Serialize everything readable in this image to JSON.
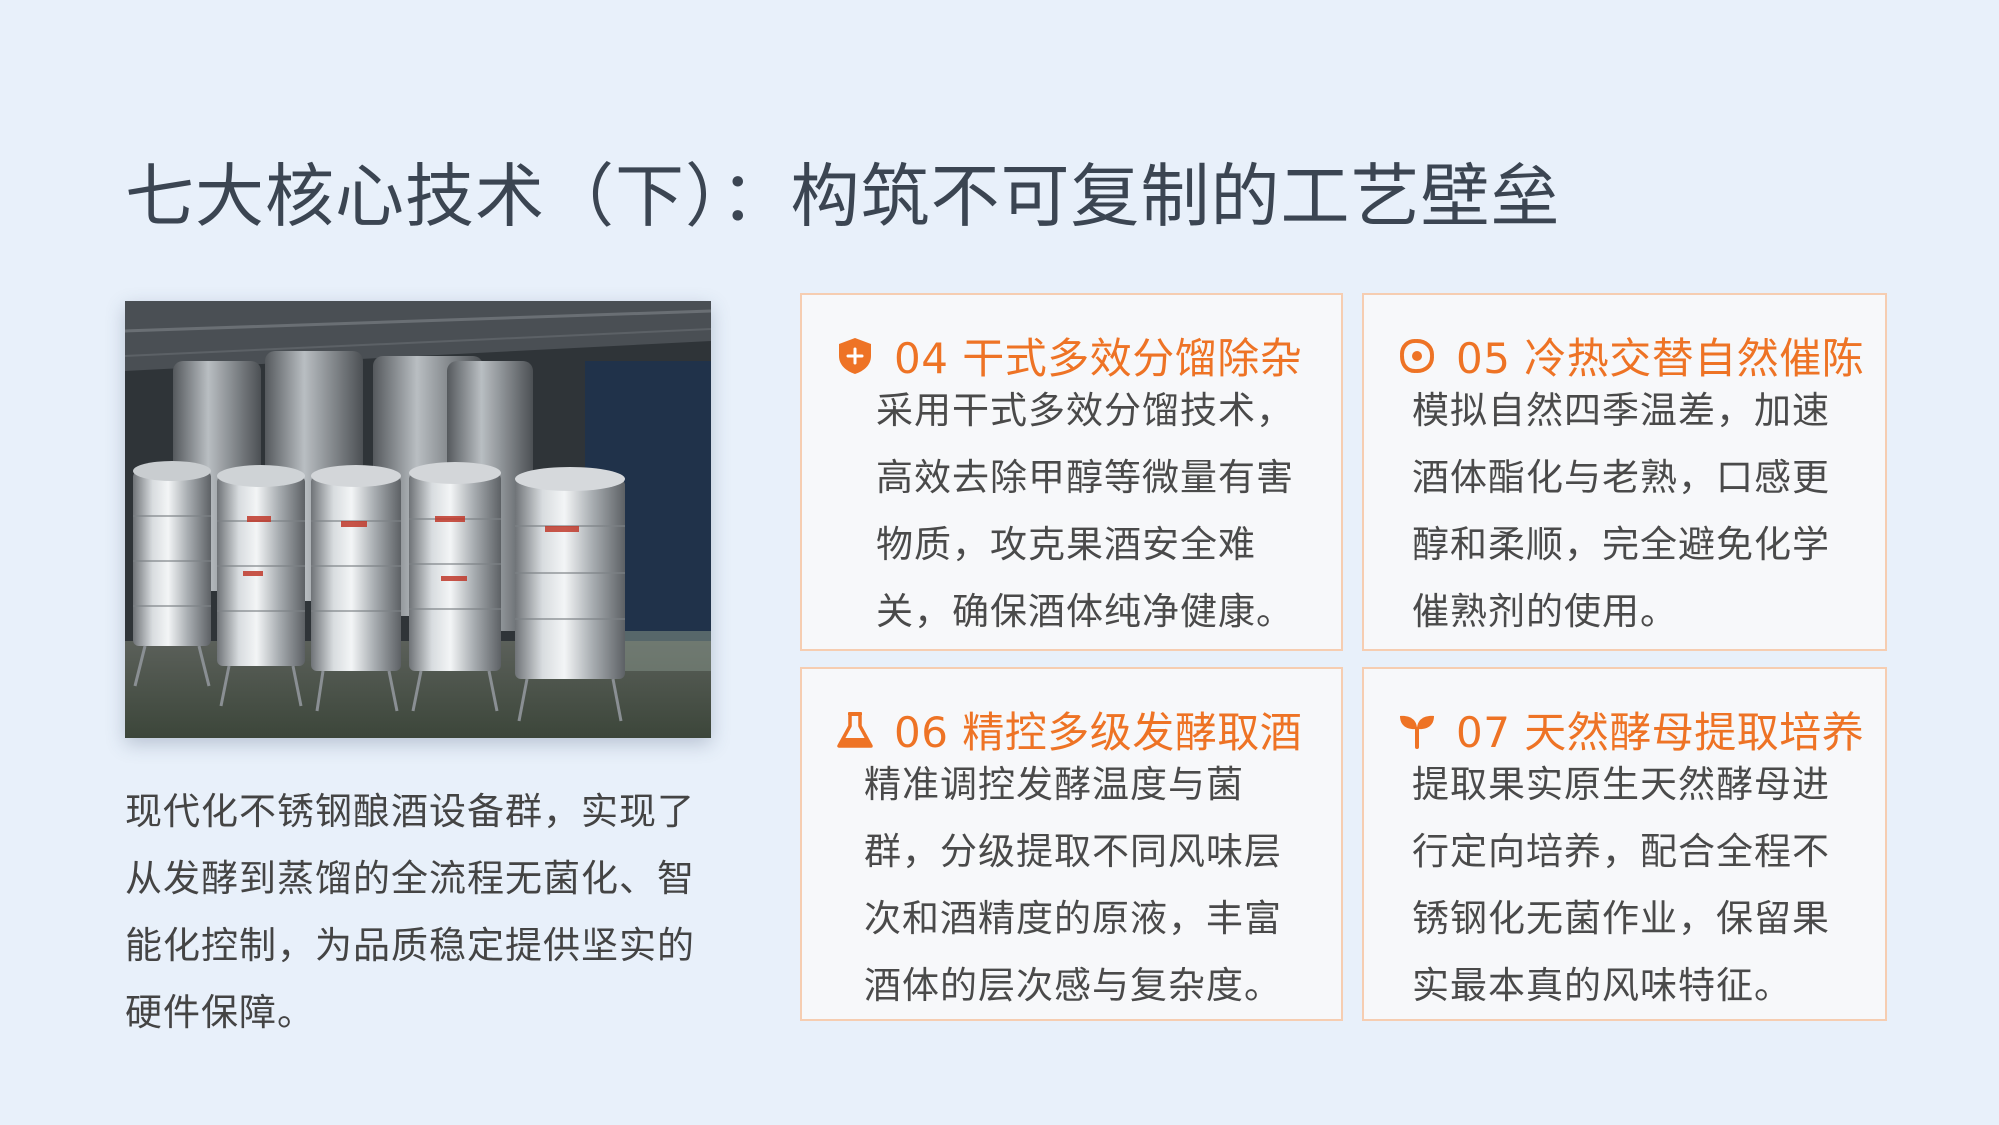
{
  "page": {
    "title": "七大核心技术（下）：构筑不可复制的工艺壁垒"
  },
  "photo": {
    "alt": "不锈钢酿酒设备"
  },
  "caption": "现代化不锈钢酿酒设备群，实现了从发酵到蒸馏的全流程无菌化、智能化控制，为品质稳定提供坚实的硬件保障。",
  "colors": {
    "accent": "#ee7325",
    "card_border": "#f6cdb1",
    "background": "#e8f0fa",
    "title": "#3b4552"
  },
  "cards": [
    {
      "icon": "shield-plus-icon",
      "title": "04 干式多效分馏除杂",
      "body": "采用干式多效分馏技术，高效去除甲醇等微量有害物质，攻克果酒安全难关，确保酒体纯净健康。"
    },
    {
      "icon": "swirl-icon",
      "title": "05 冷热交替自然催陈",
      "body": "模拟自然四季温差，加速酒体酯化与老熟，口感更醇和柔顺，完全避免化学催熟剂的使用。"
    },
    {
      "icon": "flask-icon",
      "title": "06 精控多级发酵取酒",
      "body": "精准调控发酵温度与菌群，分级提取不同风味层次和酒精度的原液，丰富酒体的层次感与复杂度。"
    },
    {
      "icon": "sprout-icon",
      "title": "07 天然酵母提取培养",
      "body": "提取果实原生天然酵母进行定向培养，配合全程不锈钢化无菌作业，保留果实最本真的风味特征。"
    }
  ]
}
